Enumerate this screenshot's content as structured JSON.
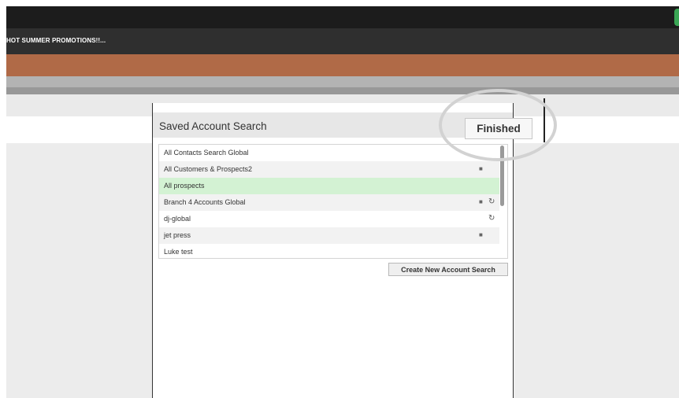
{
  "header": {
    "promo_text": "HOT SUMMER PROMOTIONS!!..."
  },
  "dialog": {
    "title": "Saved Account Search",
    "finished_label": "Finished",
    "create_label": "Create New Account Search"
  },
  "searches": [
    {
      "name": "All Contacts Search Global",
      "lock": false,
      "shared": false,
      "selected": false
    },
    {
      "name": "All Customers & Prospects2",
      "lock": true,
      "shared": false,
      "selected": false
    },
    {
      "name": "All prospects",
      "lock": false,
      "shared": false,
      "selected": true
    },
    {
      "name": "Branch 4 Accounts Global",
      "lock": true,
      "shared": true,
      "selected": false
    },
    {
      "name": "dj-global",
      "lock": false,
      "shared": true,
      "selected": false
    },
    {
      "name": "jet press",
      "lock": true,
      "shared": false,
      "selected": false
    },
    {
      "name": "Luke test",
      "lock": false,
      "shared": false,
      "selected": false
    }
  ],
  "icons": {
    "lock": "lock-icon",
    "shared": "refresh-icon"
  },
  "colors": {
    "selected_row": "#d3f2d3",
    "alt_row": "#f2f2f2",
    "header_orange": "#b06a47",
    "status_green": "#3aa655"
  }
}
